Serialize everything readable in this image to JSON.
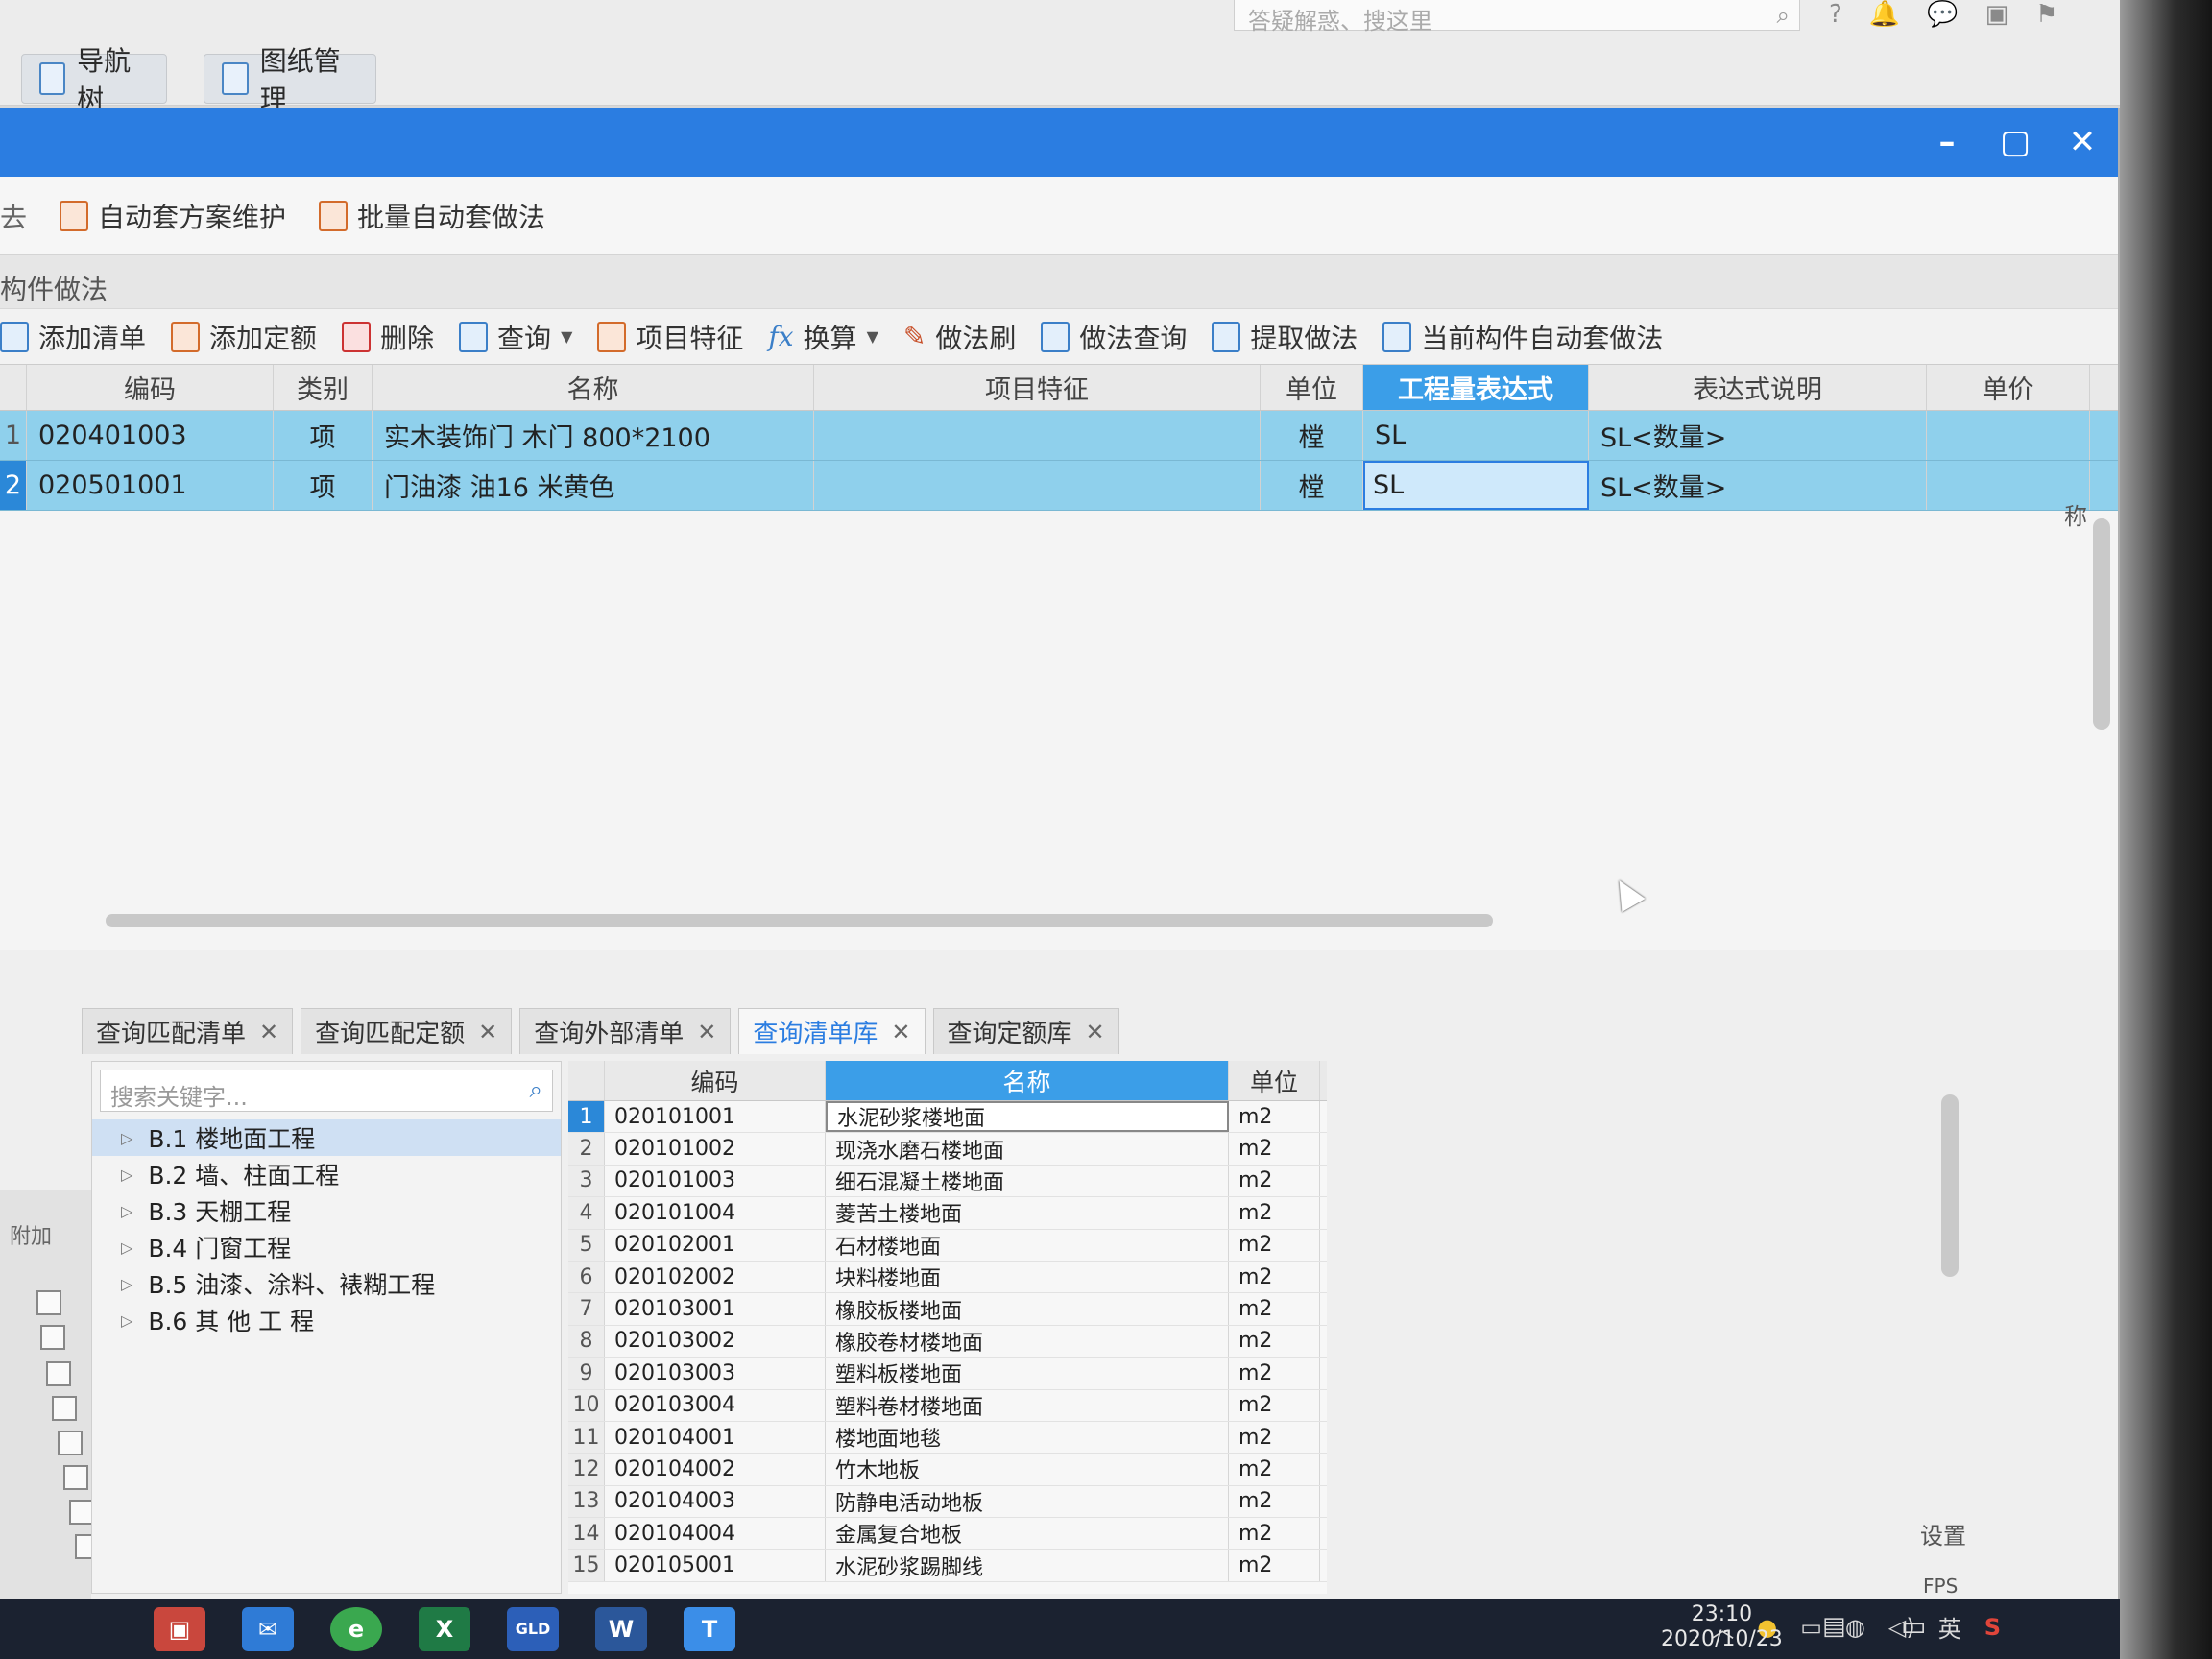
{
  "top": {
    "search_placeholder": "答疑解惑、搜这里",
    "tabs": [
      {
        "label": "导航树"
      },
      {
        "label": "图纸管理"
      }
    ]
  },
  "dialog": {
    "toolbar1": {
      "prefix": "去",
      "items": [
        {
          "label": "自动套方案维护"
        },
        {
          "label": "批量自动套做法"
        }
      ]
    },
    "section_label": "构件做法",
    "toolbar2": [
      {
        "label": "添加清单"
      },
      {
        "label": "添加定额"
      },
      {
        "label": "删除"
      },
      {
        "label": "查询"
      },
      {
        "label": "项目特征"
      },
      {
        "label": "换算"
      },
      {
        "label": "做法刷"
      },
      {
        "label": "做法查询"
      },
      {
        "label": "提取做法"
      },
      {
        "label": "当前构件自动套做法"
      }
    ],
    "upper_grid": {
      "columns": [
        "编码",
        "类别",
        "名称",
        "项目特征",
        "单位",
        "工程量表达式",
        "表达式说明",
        "单价"
      ],
      "rows": [
        {
          "idx": "1",
          "code": "020401003",
          "type": "项",
          "name": "实木装饰门 木门 800*2100",
          "feature": "",
          "unit": "樘",
          "expr": "SL",
          "desc": "SL<数量>",
          "price": ""
        },
        {
          "idx": "2",
          "code": "020501001",
          "type": "项",
          "name": "门油漆  油16 米黄色",
          "feature": "",
          "unit": "樘",
          "expr": "SL",
          "desc": "SL<数量>",
          "price": ""
        }
      ]
    },
    "bottom_tabs": [
      {
        "label": "查询匹配清单"
      },
      {
        "label": "查询匹配定额"
      },
      {
        "label": "查询外部清单"
      },
      {
        "label": "查询清单库"
      },
      {
        "label": "查询定额库"
      }
    ],
    "tree": {
      "search_placeholder": "搜索关键字...",
      "items": [
        {
          "label": "B.1  楼地面工程"
        },
        {
          "label": "B.2  墙、柱面工程"
        },
        {
          "label": "B.3  天棚工程"
        },
        {
          "label": "B.4  门窗工程"
        },
        {
          "label": "B.5  油漆、涂料、裱糊工程"
        },
        {
          "label": "B.6  其 他 工 程"
        }
      ]
    },
    "left_strip_label": "附加",
    "library": {
      "columns": [
        "编码",
        "名称",
        "单位"
      ],
      "rows": [
        {
          "n": "1",
          "code": "020101001",
          "name": "水泥砂浆楼地面",
          "unit": "m2"
        },
        {
          "n": "2",
          "code": "020101002",
          "name": "现浇水磨石楼地面",
          "unit": "m2"
        },
        {
          "n": "3",
          "code": "020101003",
          "name": "细石混凝土楼地面",
          "unit": "m2"
        },
        {
          "n": "4",
          "code": "020101004",
          "name": "菱苦土楼地面",
          "unit": "m2"
        },
        {
          "n": "5",
          "code": "020102001",
          "name": "石材楼地面",
          "unit": "m2"
        },
        {
          "n": "6",
          "code": "020102002",
          "name": "块料楼地面",
          "unit": "m2"
        },
        {
          "n": "7",
          "code": "020103001",
          "name": "橡胶板楼地面",
          "unit": "m2"
        },
        {
          "n": "8",
          "code": "020103002",
          "name": "橡胶卷材楼地面",
          "unit": "m2"
        },
        {
          "n": "9",
          "code": "020103003",
          "name": "塑料板楼地面",
          "unit": "m2"
        },
        {
          "n": "10",
          "code": "020103004",
          "name": "塑料卷材楼地面",
          "unit": "m2"
        },
        {
          "n": "11",
          "code": "020104001",
          "name": "楼地面地毯",
          "unit": "m2"
        },
        {
          "n": "12",
          "code": "020104002",
          "name": "竹木地板",
          "unit": "m2"
        },
        {
          "n": "13",
          "code": "020104003",
          "name": "防静电活动地板",
          "unit": "m2"
        },
        {
          "n": "14",
          "code": "020104004",
          "name": "金属复合地板",
          "unit": "m2"
        },
        {
          "n": "15",
          "code": "020105001",
          "name": "水泥砂浆踢脚线",
          "unit": "m2"
        }
      ]
    },
    "side_texts": {
      "right_name": "称",
      "right_setting": "设置",
      "fps": "FPS"
    }
  },
  "taskbar": {
    "apps": [
      "store",
      "mail",
      "ie",
      "excel",
      "app",
      "word",
      "t-app"
    ],
    "labels": {
      "excel": "X",
      "word": "W",
      "t": "T",
      "app": "GLD"
    },
    "ime": "英",
    "time": "23:10",
    "date": "2020/10/23"
  },
  "colors": {
    "titlebar": "#2b7de1",
    "selected_row": "#8fd0ec",
    "header_highlight": "#3b9ee8",
    "taskbar": "#1b2230"
  }
}
